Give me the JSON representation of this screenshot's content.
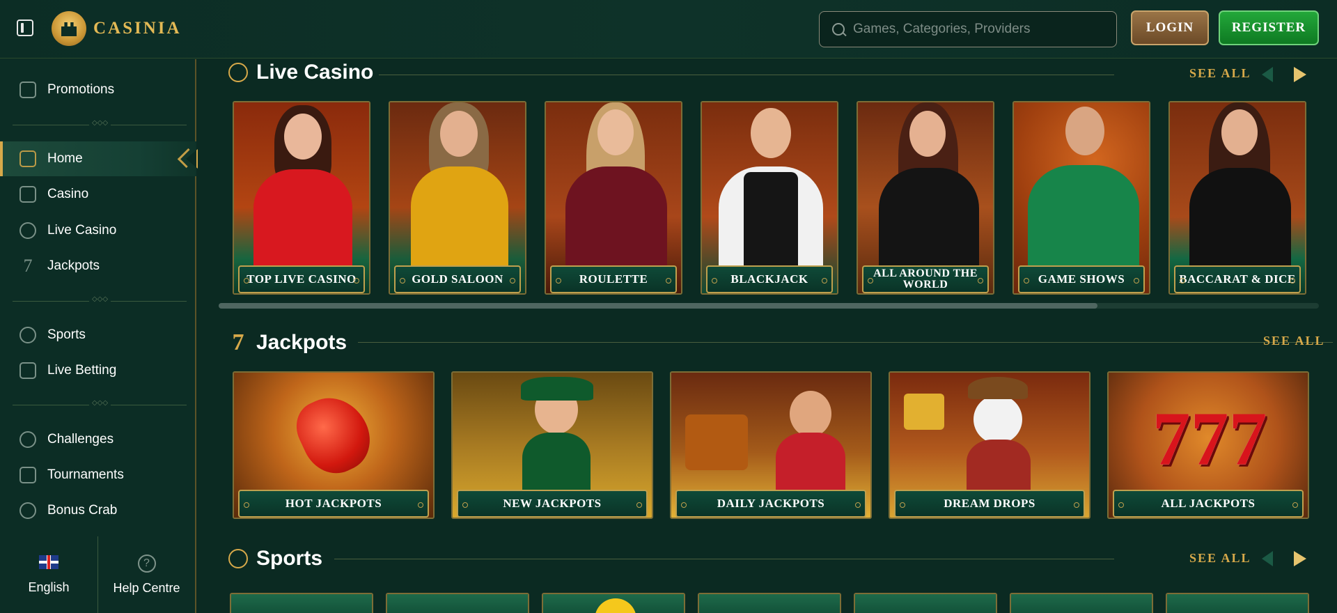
{
  "brand": {
    "name": "CASINIA"
  },
  "search": {
    "placeholder": "Games, Categories, Providers"
  },
  "auth": {
    "login_label": "LOGIN",
    "register_label": "REGISTER"
  },
  "sidebar": {
    "promotions": "Promotions",
    "items": [
      {
        "label": "Home",
        "icon": "castle-icon",
        "active": true
      },
      {
        "label": "Casino",
        "icon": "slot-machine-icon"
      },
      {
        "label": "Live Casino",
        "icon": "chip-icon"
      },
      {
        "label": "Jackpots",
        "icon": "seven-icon"
      }
    ],
    "sports_items": [
      {
        "label": "Sports",
        "icon": "ball-icon"
      },
      {
        "label": "Live Betting",
        "icon": "live-betting-icon"
      }
    ],
    "extra_items": [
      {
        "label": "Challenges",
        "icon": "challenge-icon"
      },
      {
        "label": "Tournaments",
        "icon": "trophy-icon"
      },
      {
        "label": "Bonus Crab",
        "icon": "crab-icon"
      }
    ],
    "language": "English",
    "help": "Help Centre"
  },
  "sections": {
    "live_casino": {
      "title": "Live Casino",
      "see_all": "SEE ALL",
      "cards": [
        "TOP LIVE CASINO",
        "GOLD SALOON",
        "ROULETTE",
        "BLACKJACK",
        "ALL AROUND THE WORLD",
        "GAME SHOWS",
        "BACCARAT & DICE"
      ]
    },
    "jackpots": {
      "title": "Jackpots",
      "see_all": "SEE ALL",
      "cards": [
        "HOT JACKPOTS",
        "NEW JACKPOTS",
        "DAILY JACKPOTS",
        "DREAM DROPS",
        "ALL JACKPOTS"
      ]
    },
    "sports": {
      "title": "Sports",
      "see_all": "SEE ALL"
    }
  },
  "colors": {
    "background": "#0b2a22",
    "gold": "#d7a94a",
    "register_green": "#1a9a30",
    "login_brown": "#8a6538"
  }
}
